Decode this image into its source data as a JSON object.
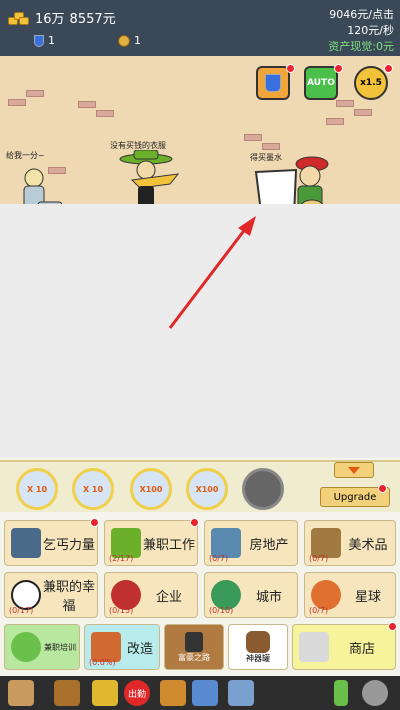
{
  "hud": {
    "gold": "16万",
    "cash": "8557元",
    "potions": "1",
    "bags": "1",
    "per_click": "9046元/点击",
    "per_second": "120元/秒",
    "assets_label": "资产现觉",
    "assets_value": ":0元"
  },
  "scene": {
    "caption_beggar": "给我一分~",
    "caption_dancer": "没有买钱的衣服",
    "caption_painter": "得买墨水",
    "auto_label": "AUTO",
    "speed_label": "x1.5"
  },
  "skills": [
    {
      "label": "X 10"
    },
    {
      "label": "X 10"
    },
    {
      "label": "X100"
    },
    {
      "label": "X100"
    }
  ],
  "upgrade_label": "Upgrade",
  "tabs": [
    {
      "label": "乞丐力量",
      "count": ""
    },
    {
      "label": "兼职工作",
      "count": "(2/17)"
    },
    {
      "label": "房地产",
      "count": "(0/7)"
    },
    {
      "label": "美术品",
      "count": "(0/7)"
    },
    {
      "label": "兼职的幸福",
      "count": "(0/17)"
    },
    {
      "label": "企业",
      "count": "(0/15)"
    },
    {
      "label": "城市",
      "count": "(0/10)"
    },
    {
      "label": "星球",
      "count": "(0/7)"
    },
    {
      "label": "兼职培训",
      "count": ""
    },
    {
      "label": "改造",
      "count": "(0.0%)"
    },
    {
      "label": "富豪之路",
      "count": ""
    },
    {
      "label": "神器罐",
      "count": ""
    },
    {
      "label": "商店",
      "count": ""
    }
  ],
  "bottom": {
    "event_label": "出勤"
  },
  "colors": {
    "hud": "#3a4858",
    "wall": "#efd9b3",
    "red_dot": "#e8222e",
    "gold": "#f2c23a"
  }
}
